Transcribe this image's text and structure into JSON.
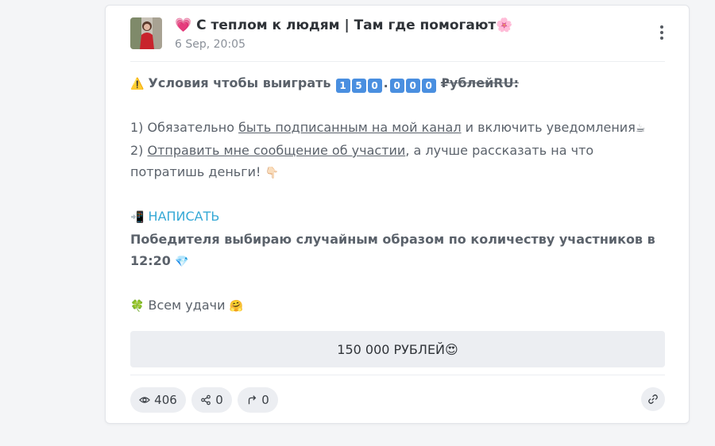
{
  "post": {
    "channel_heart": "💗",
    "channel_name": "С теплом к людям | Там где помогают",
    "channel_flower": "🌸",
    "date": "6 Sep, 20:05",
    "warning_emoji": "⚠️",
    "title_text": "Условия чтобы выиграть",
    "prize_digits": [
      "1",
      "5",
      "0",
      ".",
      "0",
      "0",
      "0"
    ],
    "prize_currency": "₽ублейRU:",
    "line1_prefix": "1) Обязательно ",
    "line1_link": "быть подписанным на мой канал",
    "line1_suffix": " и включить уведомления",
    "line1_emoji": "☕",
    "line2_prefix": "2) ",
    "line2_link": "Отправить мне сообщение об участии",
    "line2_suffix": ", а лучше рассказать на что потратишь деньги! ",
    "line2_emoji": "👇🏻",
    "write_emoji": "📲",
    "write_link": "НАПИСАТЬ",
    "winner_text": "Победителя выбираю случайным образом по количеству участников в 12:20",
    "winner_emoji": "💎",
    "luck_emoji": "🍀",
    "luck_text": " Всем удачи ",
    "luck_emoji2": "🤗"
  },
  "action_button": {
    "label": "150 000 РУБЛЕЙ",
    "emoji": "😍"
  },
  "footer": {
    "views": "406",
    "shares": "0",
    "forwards": "0"
  },
  "icons": {
    "views": "eye-icon",
    "shares": "share-icon",
    "forwards": "forward-arrow-icon",
    "link": "link-icon",
    "menu": "vertical-dots-icon"
  },
  "colors": {
    "accent_link": "#36a9d6",
    "keycap": "#4a8fe0"
  }
}
